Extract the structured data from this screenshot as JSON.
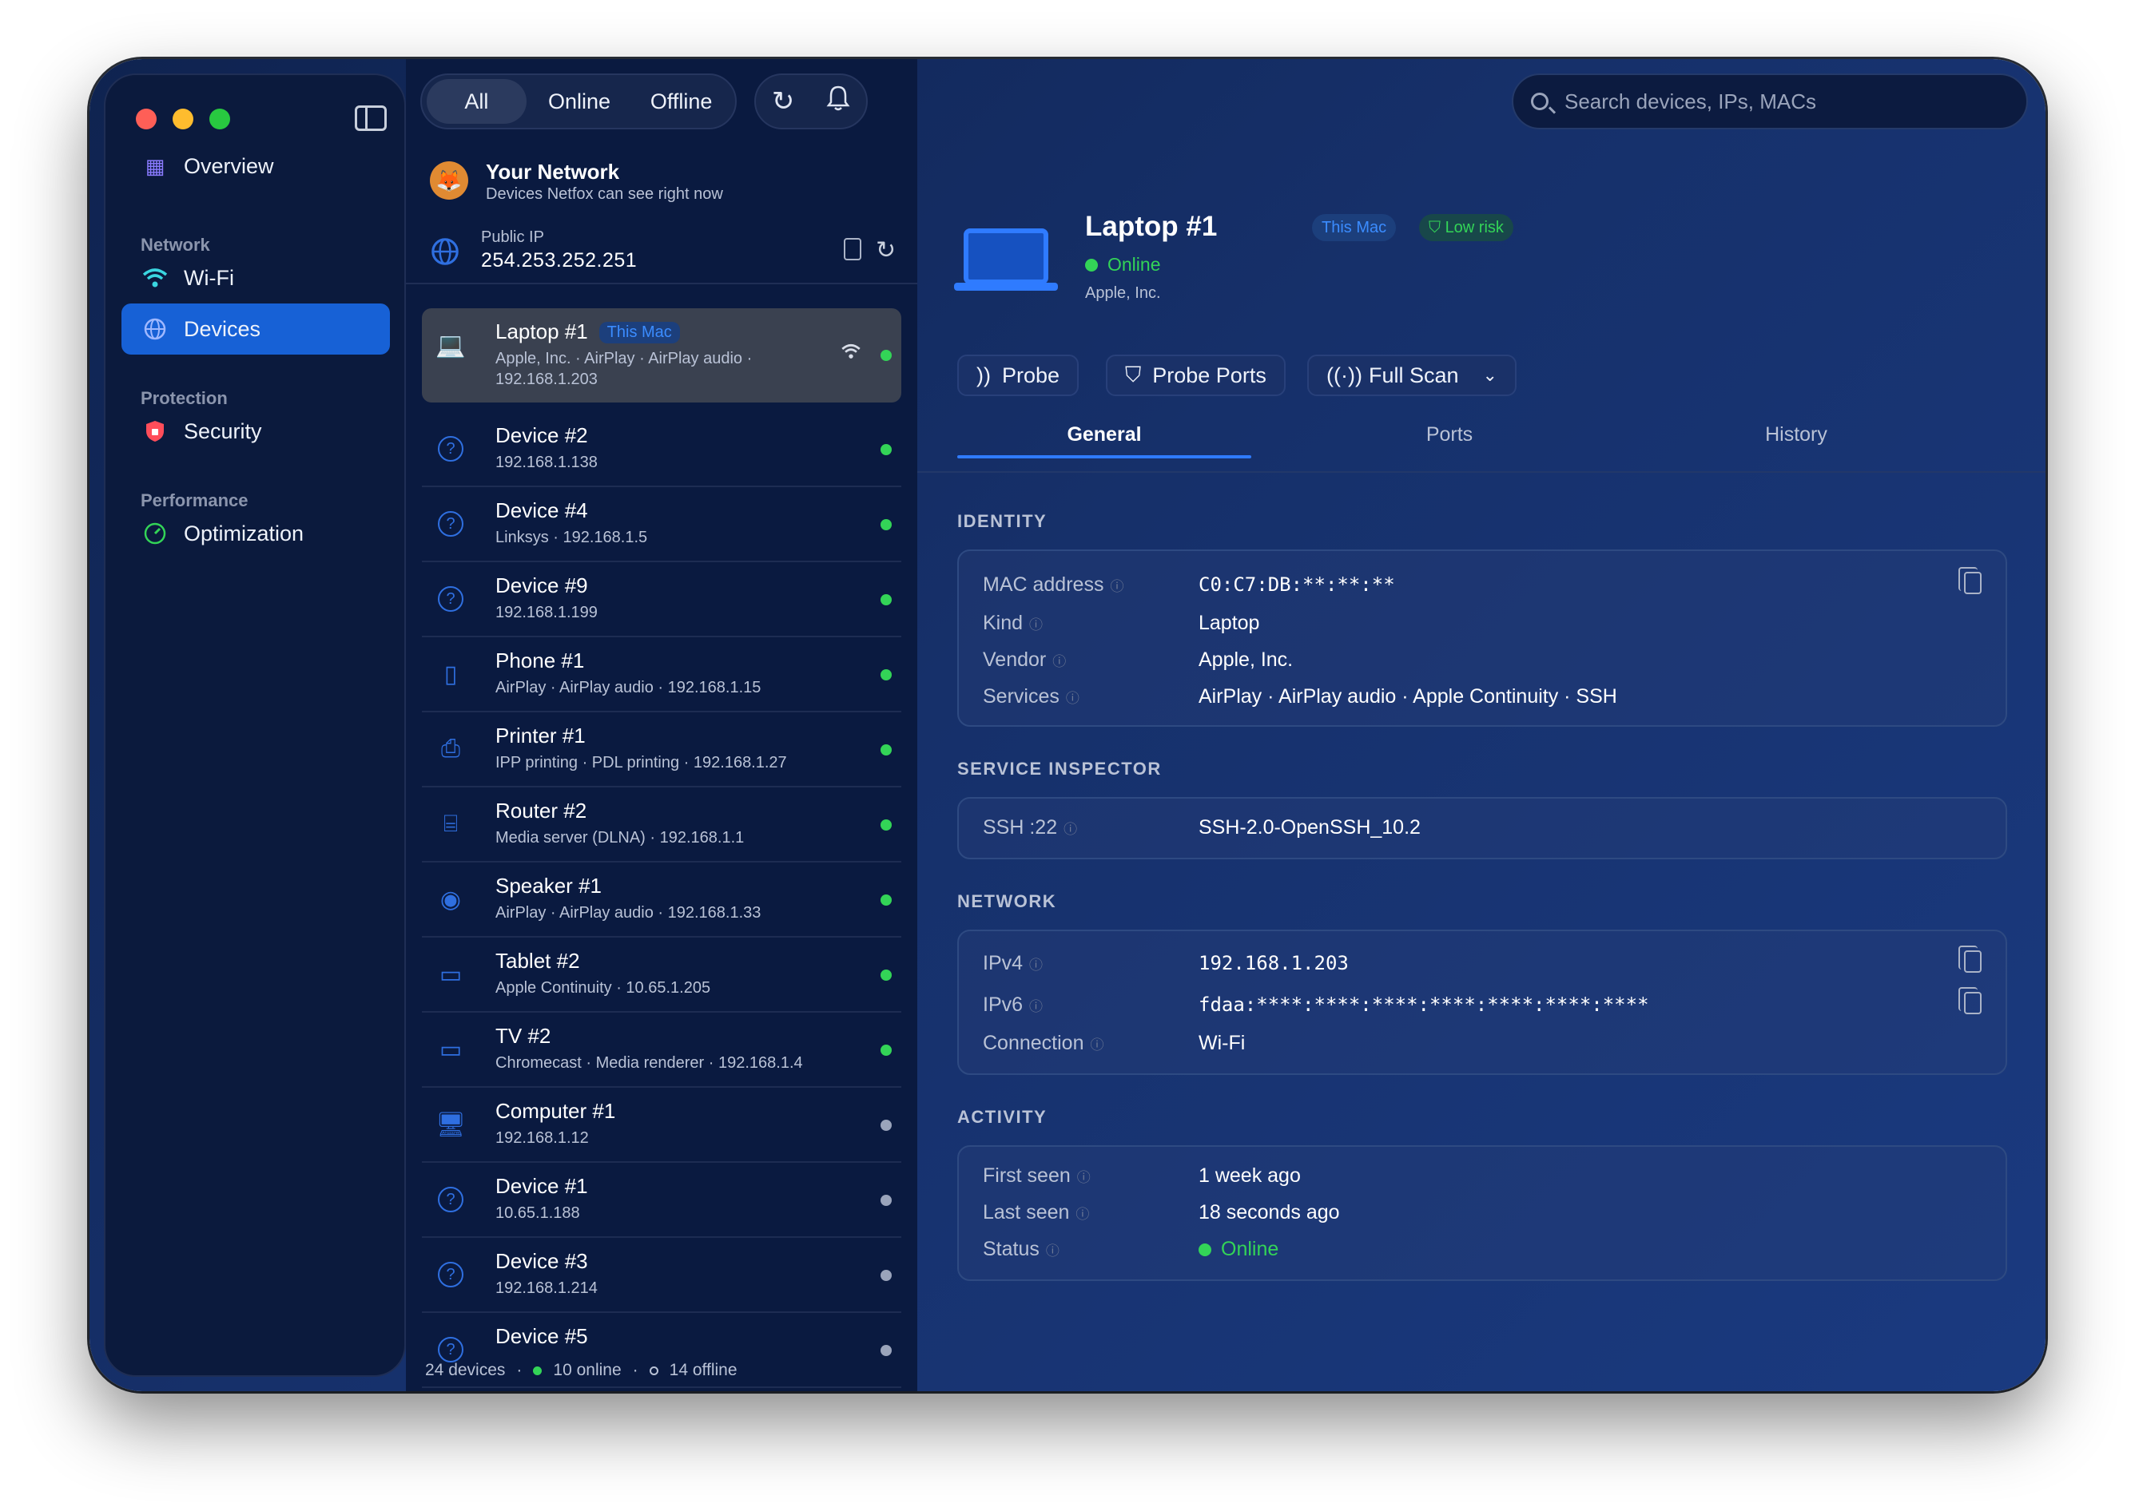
{
  "sidebar": {
    "items": [
      {
        "label": "Overview",
        "icon": "grid-icon"
      },
      {
        "label": "Wi-Fi",
        "icon": "wifi-icon"
      },
      {
        "label": "Devices",
        "icon": "globe-icon"
      },
      {
        "label": "Security",
        "icon": "shield-icon"
      },
      {
        "label": "Optimization",
        "icon": "gauge-icon"
      }
    ],
    "sections": {
      "network": "Network",
      "protection": "Protection",
      "performance": "Performance"
    }
  },
  "filter": {
    "all": "All",
    "online": "Online",
    "offline": "Offline",
    "selected": "All"
  },
  "network": {
    "title": "Your Network",
    "subtitle": "Devices Netfox can see right now",
    "public_ip_label": "Public IP",
    "public_ip": "254.253.252.251"
  },
  "devices": [
    {
      "name": "Laptop #1",
      "badge": "This Mac",
      "sub": "Apple, Inc. · AirPlay · AirPlay audio · 192.168.1.203",
      "online": true,
      "icon": "laptop-icon"
    },
    {
      "name": "Device #2",
      "sub": "192.168.1.138",
      "online": true,
      "icon": "question-icon"
    },
    {
      "name": "Device #4",
      "sub": "Linksys · 192.168.1.5",
      "online": true,
      "icon": "question-icon"
    },
    {
      "name": "Device #9",
      "sub": "192.168.1.199",
      "online": true,
      "icon": "question-icon"
    },
    {
      "name": "Phone #1",
      "sub": "AirPlay · AirPlay audio · 192.168.1.15",
      "online": true,
      "icon": "phone-icon"
    },
    {
      "name": "Printer #1",
      "sub": "IPP printing · PDL printing · 192.168.1.27",
      "online": true,
      "icon": "printer-icon"
    },
    {
      "name": "Router #2",
      "sub": "Media server (DLNA) · 192.168.1.1",
      "online": true,
      "icon": "router-icon"
    },
    {
      "name": "Speaker #1",
      "sub": "AirPlay · AirPlay audio · 192.168.1.33",
      "online": true,
      "icon": "speaker-icon"
    },
    {
      "name": "Tablet #2",
      "sub": "Apple Continuity · 10.65.1.205",
      "online": true,
      "icon": "tablet-icon"
    },
    {
      "name": "TV #2",
      "sub": "Chromecast · Media renderer · 192.168.1.4",
      "online": true,
      "icon": "tv-icon"
    },
    {
      "name": "Computer #1",
      "sub": "192.168.1.12",
      "online": false,
      "icon": "desktop-icon"
    },
    {
      "name": "Device #1",
      "sub": "10.65.1.188",
      "online": false,
      "icon": "question-icon"
    },
    {
      "name": "Device #3",
      "sub": "192.168.1.214",
      "online": false,
      "icon": "question-icon"
    },
    {
      "name": "Device #5",
      "sub": "",
      "online": false,
      "icon": "question-icon"
    }
  ],
  "footer": {
    "count": "24 devices",
    "online": "10 online",
    "offline": "14 offline"
  },
  "search": {
    "placeholder": "Search devices, IPs, MACs"
  },
  "detail": {
    "title": "Laptop #1",
    "badge_mac": "This Mac",
    "badge_risk": "Low risk",
    "status": "Online",
    "vendor": "Apple, Inc.",
    "actions": {
      "probe": "Probe",
      "probe_ports": "Probe Ports",
      "full_scan": "Full Scan"
    },
    "tabs": [
      "General",
      "Ports",
      "History"
    ],
    "sections": {
      "identity": "IDENTITY",
      "service": "SERVICE INSPECTOR",
      "network": "NETWORK",
      "activity": "ACTIVITY"
    },
    "identity": [
      {
        "k": "MAC address",
        "v": "C0:C7:DB:**:**:**"
      },
      {
        "k": "Kind",
        "v": "Laptop"
      },
      {
        "k": "Vendor",
        "v": "Apple, Inc."
      },
      {
        "k": "Services",
        "v": "AirPlay · AirPlay audio · Apple Continuity · SSH"
      }
    ],
    "service": {
      "k": "SSH :22",
      "v": "SSH-2.0-OpenSSH_10.2"
    },
    "network": [
      {
        "k": "IPv4",
        "v": "192.168.1.203"
      },
      {
        "k": "IPv6",
        "v": "fdaa:****:****:****:****:****:****:****"
      },
      {
        "k": "Connection",
        "v": "Wi-Fi"
      }
    ],
    "activity": [
      {
        "k": "First seen",
        "v": "1 week ago"
      },
      {
        "k": "Last seen",
        "v": "18 seconds ago"
      },
      {
        "k": "Status",
        "v": "Online"
      }
    ]
  },
  "colors": {
    "accent": "#2f7bff",
    "online": "#33d457",
    "offline": "#9aa4bb",
    "risk": "#33d457"
  }
}
